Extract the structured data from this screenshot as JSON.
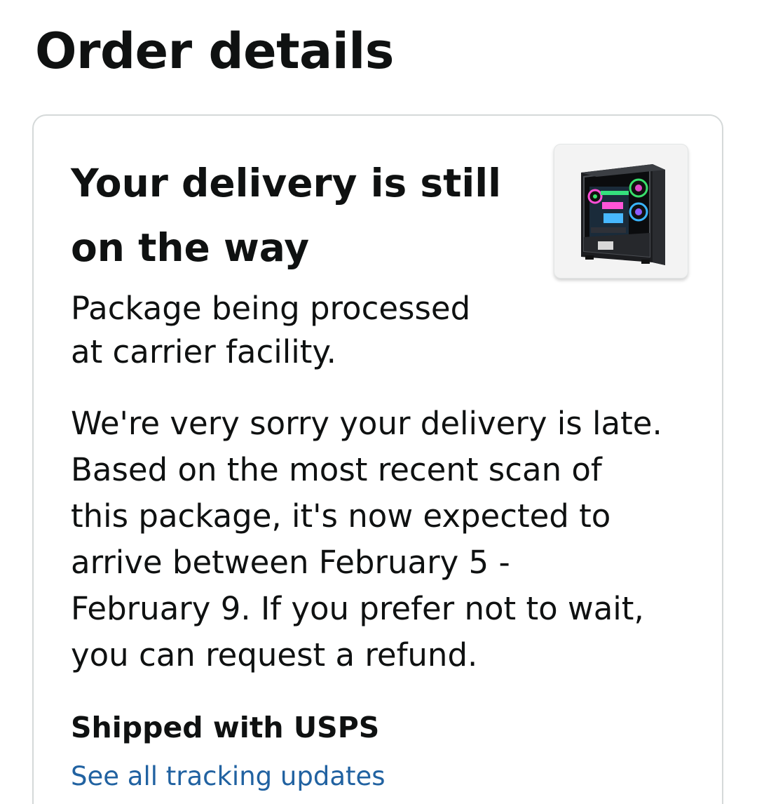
{
  "header": {
    "title": "Order details"
  },
  "delivery_card": {
    "status_title_line1": "Your delivery is still",
    "status_title_line2": "on the way",
    "status_subtitle_line1": "Package being processed",
    "status_subtitle_line2": "at carrier facility.",
    "message_lines": [
      "We're very sorry your delivery is late.",
      "Based on the most recent scan of",
      "this package, it's now expected to",
      "arrive between February 5 -",
      "February 9. If you prefer not to wait,",
      "you can request a refund."
    ],
    "carrier": "Shipped with USPS",
    "tracking_link": "See all tracking updates",
    "product_image": "gaming-pc-case-image"
  },
  "colors": {
    "text": "#0f1111",
    "link": "#2162a1",
    "card_border": "#d5d9d9",
    "thumb_background": "#f3f3f3"
  }
}
